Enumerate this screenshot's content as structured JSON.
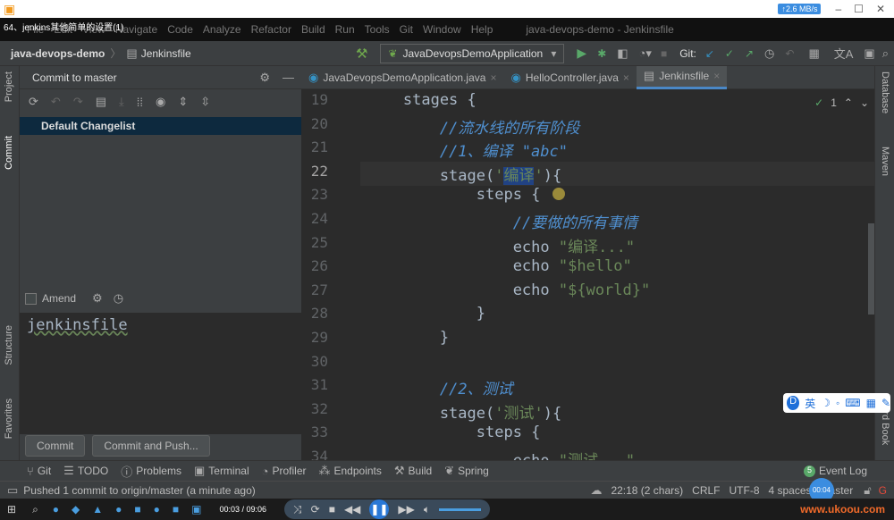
{
  "window": {
    "speed": "↑2.6 MB/s",
    "video_title": "64、jenkins其他简单的设置(1)",
    "ide_title": "java-devops-demo - Jenkinsfile"
  },
  "menu": [
    "File",
    "Edit",
    "View",
    "Navigate",
    "Code",
    "Analyze",
    "Refactor",
    "Build",
    "Run",
    "Tools",
    "Git",
    "Window",
    "Help"
  ],
  "navbar": {
    "project": "java-devops-demo",
    "file": "Jenkinsfile",
    "run_config": "JavaDevopsDemoApplication",
    "git_label": "Git:"
  },
  "left_strip": [
    "Project",
    "Commit",
    "Structure",
    "Favorites"
  ],
  "right_strip": [
    "Database",
    "Maven",
    "Word Book"
  ],
  "commit": {
    "title": "Commit to master",
    "changelist": "Default Changelist",
    "amend": "Amend",
    "message": "jenkinsfile",
    "commit_btn": "Commit",
    "commit_push_btn": "Commit and Push..."
  },
  "tabs": [
    {
      "label": "JavaDevopsDemoApplication.java",
      "active": false
    },
    {
      "label": "HelloController.java",
      "active": false
    },
    {
      "label": "Jenkinsfile",
      "active": true
    }
  ],
  "editor": {
    "inspection_count": "1",
    "current_line": 22,
    "lines": [
      {
        "n": 19,
        "tokens": [
          {
            "t": "        stages {",
            "k": "plain"
          }
        ]
      },
      {
        "n": 20,
        "tokens": [
          {
            "t": "            ",
            "k": "plain"
          },
          {
            "t": "//流水线的所有阶段",
            "k": "comment"
          }
        ]
      },
      {
        "n": 21,
        "tokens": [
          {
            "t": "            ",
            "k": "plain"
          },
          {
            "t": "//1、编译 \"abc\"",
            "k": "comment"
          }
        ]
      },
      {
        "n": 22,
        "tokens": [
          {
            "t": "            stage(",
            "k": "plain"
          },
          {
            "t": "'",
            "k": "string"
          },
          {
            "t": "编译",
            "k": "sel"
          },
          {
            "t": "'",
            "k": "string"
          },
          {
            "t": "){",
            "k": "plain"
          }
        ]
      },
      {
        "n": 23,
        "tokens": [
          {
            "t": "                steps { ",
            "k": "plain"
          }
        ]
      },
      {
        "n": 24,
        "tokens": [
          {
            "t": "                    ",
            "k": "plain"
          },
          {
            "t": "//要做的所有事情",
            "k": "comment"
          }
        ]
      },
      {
        "n": 25,
        "tokens": [
          {
            "t": "                    echo ",
            "k": "plain"
          },
          {
            "t": "\"编译...\"",
            "k": "string"
          }
        ]
      },
      {
        "n": 26,
        "tokens": [
          {
            "t": "                    echo ",
            "k": "plain"
          },
          {
            "t": "\"$hello\"",
            "k": "string"
          }
        ]
      },
      {
        "n": 27,
        "tokens": [
          {
            "t": "                    echo ",
            "k": "plain"
          },
          {
            "t": "\"${world}\"",
            "k": "string"
          }
        ]
      },
      {
        "n": 28,
        "tokens": [
          {
            "t": "                }",
            "k": "plain"
          }
        ]
      },
      {
        "n": 29,
        "tokens": [
          {
            "t": "            }",
            "k": "plain"
          }
        ]
      },
      {
        "n": 30,
        "tokens": [
          {
            "t": "",
            "k": "plain"
          }
        ]
      },
      {
        "n": 31,
        "tokens": [
          {
            "t": "            ",
            "k": "plain"
          },
          {
            "t": "//2、测试",
            "k": "comment"
          }
        ]
      },
      {
        "n": 32,
        "tokens": [
          {
            "t": "            stage(",
            "k": "plain"
          },
          {
            "t": "'测试'",
            "k": "string"
          },
          {
            "t": "){",
            "k": "plain"
          }
        ]
      },
      {
        "n": 33,
        "tokens": [
          {
            "t": "                steps {",
            "k": "plain"
          }
        ]
      },
      {
        "n": 34,
        "tokens": [
          {
            "t": "                    echo ",
            "k": "plain"
          },
          {
            "t": "\"测试...\"",
            "k": "string"
          }
        ]
      }
    ]
  },
  "toolwindows": [
    "Git",
    "TODO",
    "Problems",
    "Terminal",
    "Profiler",
    "Endpoints",
    "Build",
    "Spring"
  ],
  "event_log": "Event Log",
  "status": {
    "message": "Pushed 1 commit to origin/master (a minute ago)",
    "position": "22:18 (2 chars)",
    "line_sep": "CRLF",
    "encoding": "UTF-8",
    "indent": "4 spaces",
    "branch": "master"
  },
  "player": {
    "time": "00:03 / 09:06",
    "bubble": "00:04",
    "watermark": "www.ukoou.com"
  },
  "ime": {
    "label": "英"
  }
}
